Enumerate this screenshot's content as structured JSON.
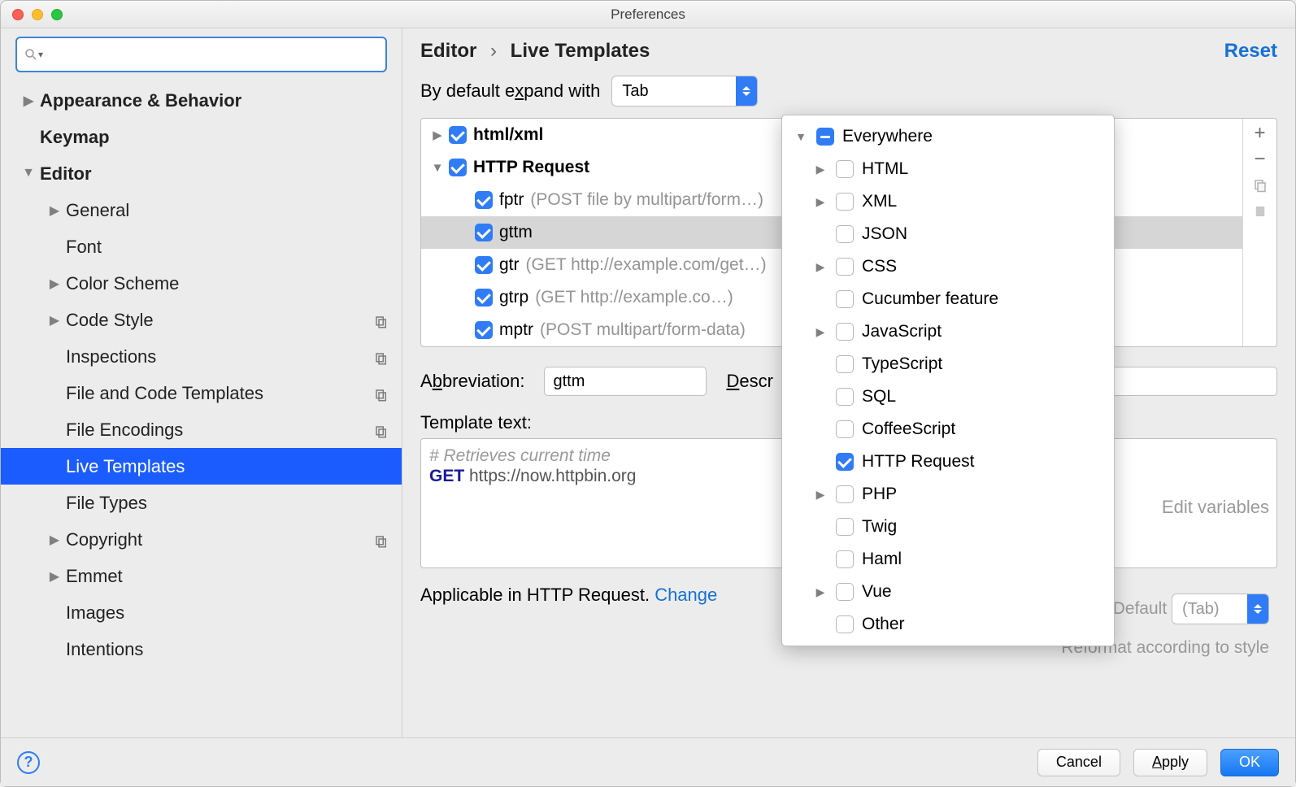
{
  "window": {
    "title": "Preferences"
  },
  "sidebar": {
    "search_placeholder": "",
    "items": [
      {
        "label": "Appearance & Behavior",
        "depth": 0,
        "bold": true,
        "expand": "closed"
      },
      {
        "label": "Keymap",
        "depth": 0,
        "bold": true,
        "expand": "none"
      },
      {
        "label": "Editor",
        "depth": 0,
        "bold": true,
        "expand": "open"
      },
      {
        "label": "General",
        "depth": 1,
        "expand": "closed"
      },
      {
        "label": "Font",
        "depth": 1,
        "expand": "none"
      },
      {
        "label": "Color Scheme",
        "depth": 1,
        "expand": "closed"
      },
      {
        "label": "Code Style",
        "depth": 1,
        "expand": "closed",
        "scheme_icon": true
      },
      {
        "label": "Inspections",
        "depth": 1,
        "expand": "none",
        "scheme_icon": true
      },
      {
        "label": "File and Code Templates",
        "depth": 1,
        "expand": "none",
        "scheme_icon": true
      },
      {
        "label": "File Encodings",
        "depth": 1,
        "expand": "none",
        "scheme_icon": true
      },
      {
        "label": "Live Templates",
        "depth": 1,
        "expand": "none",
        "selected": true
      },
      {
        "label": "File Types",
        "depth": 1,
        "expand": "none"
      },
      {
        "label": "Copyright",
        "depth": 1,
        "expand": "closed",
        "scheme_icon": true
      },
      {
        "label": "Emmet",
        "depth": 1,
        "expand": "closed"
      },
      {
        "label": "Images",
        "depth": 1,
        "expand": "none"
      },
      {
        "label": "Intentions",
        "depth": 1,
        "expand": "none"
      }
    ]
  },
  "breadcrumb": {
    "root": "Editor",
    "leaf": "Live Templates"
  },
  "reset_label": "Reset",
  "expand": {
    "label_pre": "By default e",
    "label_u": "x",
    "label_post": "pand with",
    "value": "Tab"
  },
  "groups": [
    {
      "name": "html/xml",
      "expanded": false,
      "checked": true,
      "items": []
    },
    {
      "name": "HTTP Request",
      "expanded": true,
      "checked": true,
      "items": [
        {
          "abbr": "fptr",
          "desc": "(POST file by multipart/form…)",
          "checked": true
        },
        {
          "abbr": "gttm",
          "desc": "",
          "checked": true,
          "selected": true
        },
        {
          "abbr": "gtr",
          "desc": "(GET http://example.com/get…)",
          "checked": true
        },
        {
          "abbr": "gtrp",
          "desc": "(GET http://example.co…)",
          "checked": true
        },
        {
          "abbr": "mptr",
          "desc": "(POST multipart/form-data)",
          "checked": true
        }
      ]
    }
  ],
  "toolbar": {
    "add": "+",
    "remove": "−"
  },
  "form": {
    "abbr_label_pre": "A",
    "abbr_label_u": "b",
    "abbr_label_post": "breviation:",
    "abbr_value": "gttm",
    "desc_label_pre": "",
    "desc_label_u": "D",
    "desc_label_post": "escr",
    "tt_label_pre": "",
    "tt_label_u": "T",
    "tt_label_post": "emplate text:",
    "template_comment": "# Retrieves current time",
    "template_kw": "GET",
    "template_rest": " https://now.httpbin.org",
    "edit_vars": "Edit variables"
  },
  "options": {
    "expand_label_pre": "Expand with   Defaul",
    "expand_label_u": "t",
    "expand_value": "(Tab)",
    "reformat_pre": "",
    "reformat_u": "R",
    "reformat_post": "eformat according to style"
  },
  "applicable": {
    "text": "Applicable in HTTP Request. ",
    "link": "Change"
  },
  "popup": {
    "root": {
      "label": "Everywhere",
      "state": "indeterminate"
    },
    "items": [
      {
        "label": "HTML",
        "state": "unchecked",
        "expandable": true
      },
      {
        "label": "XML",
        "state": "unchecked",
        "expandable": true
      },
      {
        "label": "JSON",
        "state": "unchecked",
        "expandable": false
      },
      {
        "label": "CSS",
        "state": "unchecked",
        "expandable": true
      },
      {
        "label": "Cucumber feature",
        "state": "unchecked",
        "expandable": false
      },
      {
        "label": "JavaScript",
        "state": "unchecked",
        "expandable": true
      },
      {
        "label": "TypeScript",
        "state": "unchecked",
        "expandable": false
      },
      {
        "label": "SQL",
        "state": "unchecked",
        "expandable": false
      },
      {
        "label": "CoffeeScript",
        "state": "unchecked",
        "expandable": false
      },
      {
        "label": "HTTP Request",
        "state": "checked",
        "expandable": false
      },
      {
        "label": "PHP",
        "state": "unchecked",
        "expandable": true
      },
      {
        "label": "Twig",
        "state": "unchecked",
        "expandable": false
      },
      {
        "label": "Haml",
        "state": "unchecked",
        "expandable": false
      },
      {
        "label": "Vue",
        "state": "unchecked",
        "expandable": true
      },
      {
        "label": "Other",
        "state": "unchecked",
        "expandable": false
      }
    ]
  },
  "buttons": {
    "cancel": "Cancel",
    "apply_u": "A",
    "apply_post": "pply",
    "ok": "OK"
  }
}
